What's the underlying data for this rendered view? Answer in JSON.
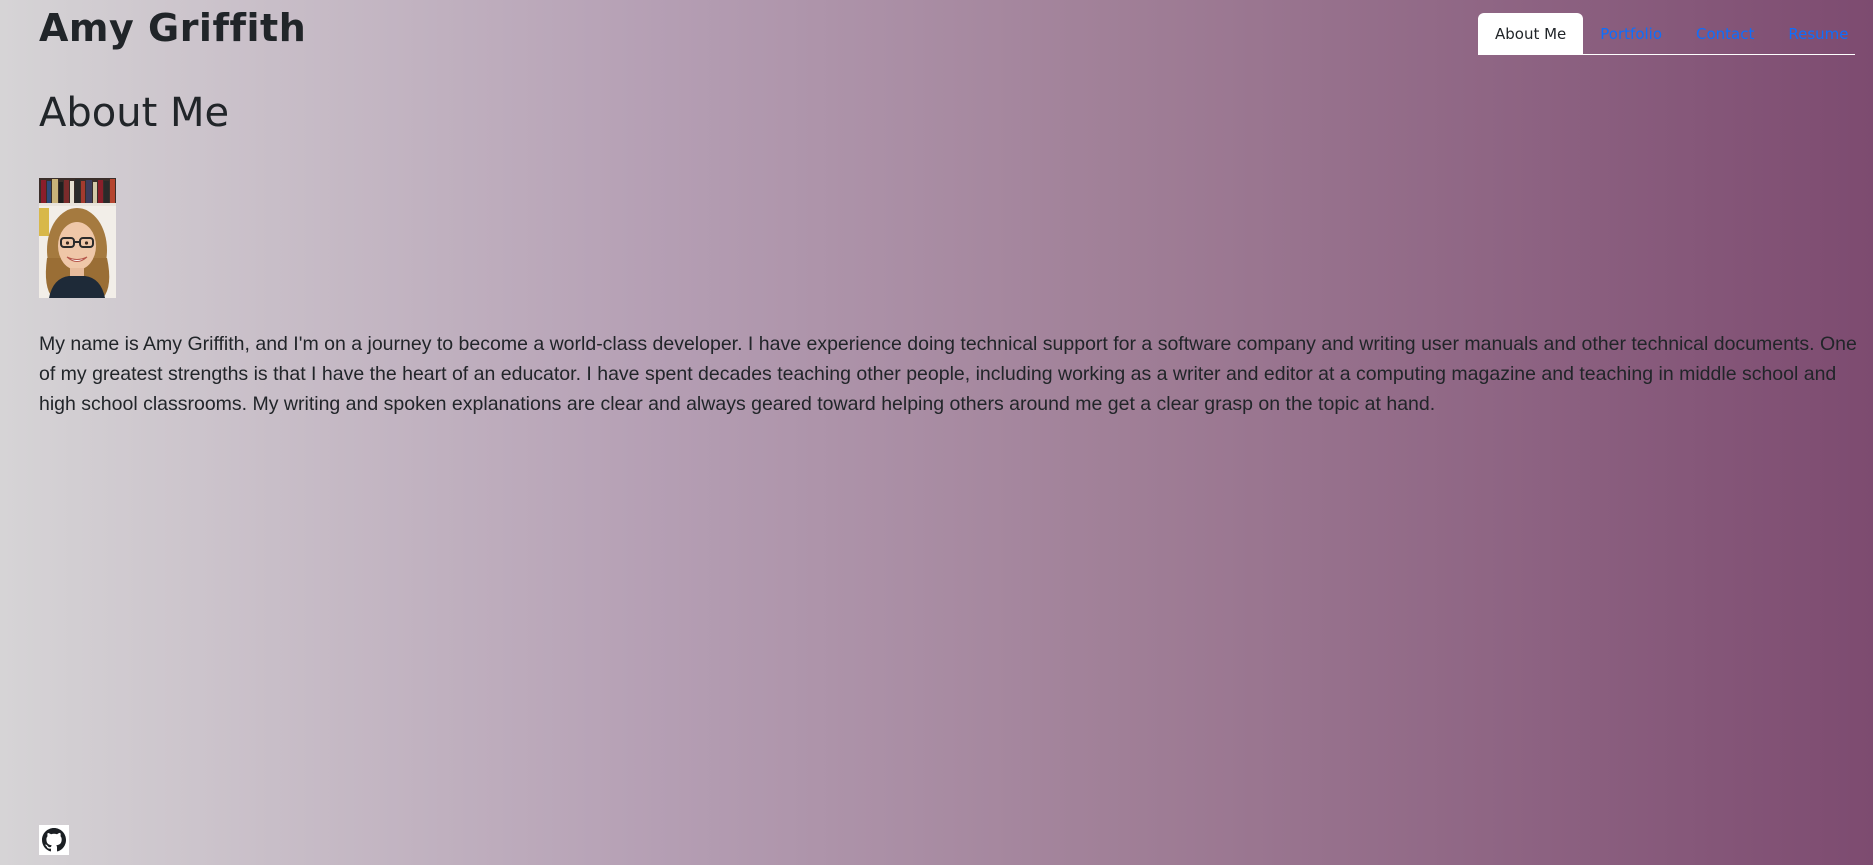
{
  "header": {
    "site_title": "Amy Griffith"
  },
  "nav": {
    "tabs": [
      {
        "label": "About Me",
        "active": true
      },
      {
        "label": "Portfolio",
        "active": false
      },
      {
        "label": "Contact",
        "active": false
      },
      {
        "label": "Resume",
        "active": false
      }
    ]
  },
  "main": {
    "heading": "About Me",
    "bio": "My name is Amy Griffith, and I'm on a journey to become a world-class developer. I have experience doing technical support for a software company and writing user manuals and other technical documents. One of my greatest strengths is that I have the heart of an educator. I have spent decades teaching other people, including working as a writer and editor at a computing magazine and teaching in middle school and high school classrooms. My writing and spoken explanations are clear and always geared toward helping others around me get a clear grasp on the topic at hand."
  },
  "footer": {
    "github_icon": "github-icon"
  },
  "colors": {
    "gradient_start": "#d6d4d6",
    "gradient_end": "#7d4b70",
    "link": "#0d6efd",
    "text": "#212529",
    "active_tab_bg": "#ffffff"
  }
}
